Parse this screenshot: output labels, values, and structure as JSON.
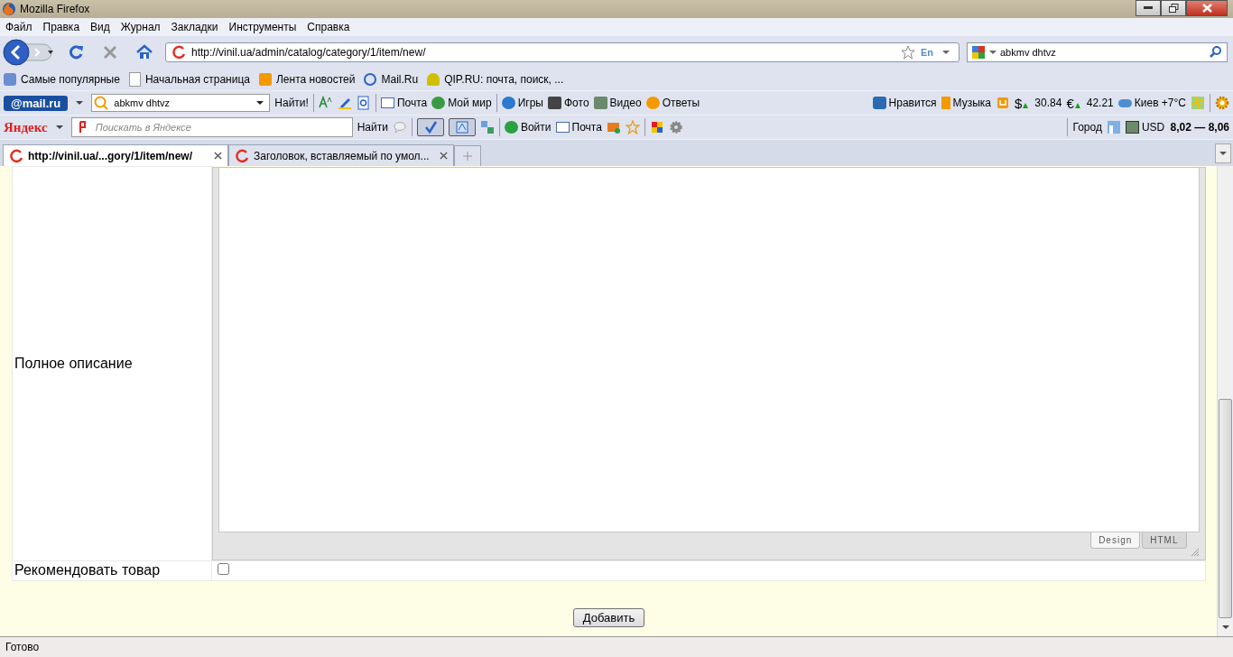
{
  "window": {
    "title": "Mozilla Firefox"
  },
  "menu": [
    "Файл",
    "Правка",
    "Вид",
    "Журнал",
    "Закладки",
    "Инструменты",
    "Справка"
  ],
  "nav": {
    "url": "http://vinil.ua/admin/catalog/category/1/item/new/",
    "lang": "En",
    "search_value": "abkmv dhtvz"
  },
  "bookmarks": [
    "Самые популярные",
    "Начальная страница",
    "Лента новостей",
    "Mail.Ru",
    "QIP.RU: почта, поиск, ..."
  ],
  "mail_toolbar": {
    "logo": "@mail.ru",
    "search_value": "abkmv dhtvz",
    "find_button": "Найти!",
    "links": [
      "Почта",
      "Мой мир",
      "Игры",
      "Фото",
      "Видео",
      "Ответы"
    ],
    "right": [
      "Нравится",
      "Музыка"
    ],
    "usd_sign": "$",
    "usd": "30.84",
    "eur_sign": "€",
    "eur": "42.21",
    "weather": "Киев +7°C"
  },
  "yandex_toolbar": {
    "logo": "Яндекс",
    "placeholder": "Поискать в Яндексе",
    "find_button": "Найти",
    "login": "Войти",
    "mail": "Почта",
    "city": "Город",
    "currency": "USD",
    "rate": "8,02 — 8,06"
  },
  "tabs": [
    {
      "label": "http://vinil.ua/...gory/1/item/new/",
      "selected": true
    },
    {
      "label": "Заголовок, вставляемый по умол...",
      "selected": false
    }
  ],
  "form": {
    "rows": [
      {
        "kind": "editor",
        "label": "Полное описание",
        "editor_tabs": [
          {
            "label": "Design",
            "selected": true
          },
          {
            "label": "HTML",
            "selected": false
          }
        ]
      },
      {
        "kind": "checkbox",
        "label": "Рекомендовать товар",
        "checked": false
      }
    ],
    "submit": "Добавить"
  },
  "status_bar": "Готово"
}
